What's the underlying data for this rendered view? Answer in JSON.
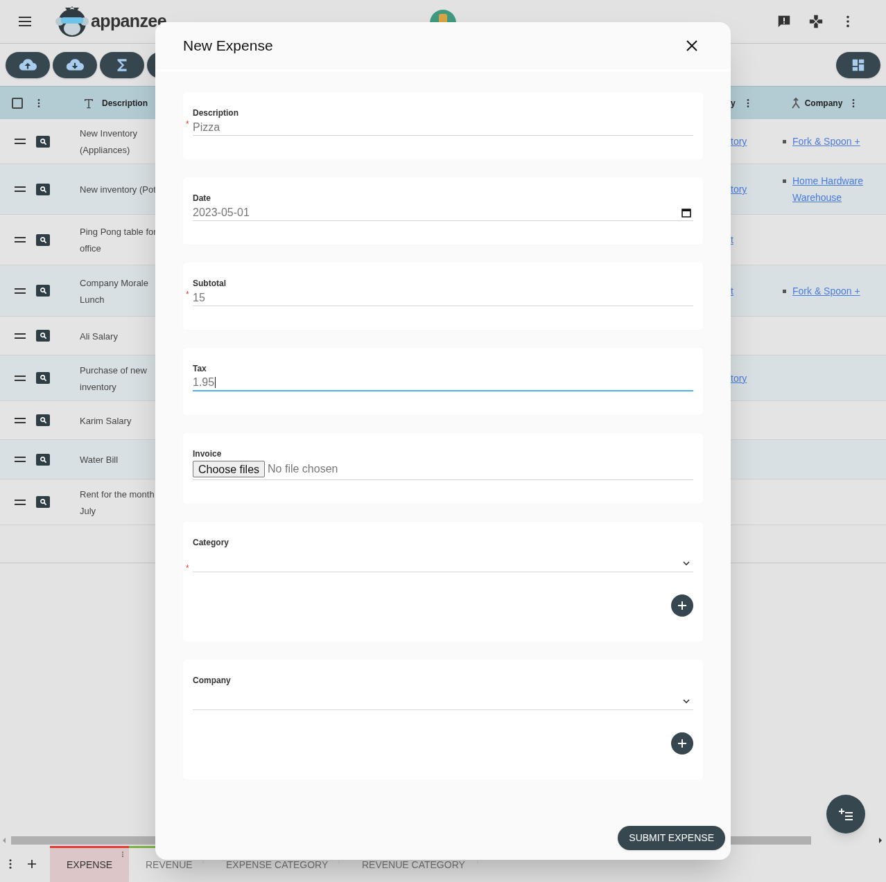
{
  "app": {
    "brand": "appanzee"
  },
  "table": {
    "select_all_checked": false,
    "columns": [
      {
        "label": "Description"
      },
      {
        "label": "y"
      },
      {
        "label": "Company"
      }
    ],
    "rows": [
      {
        "description": "New Inventory (Appliances)",
        "partial_link": "tory",
        "company": "Fork & Spoon +"
      },
      {
        "description": "New inventory (Pot",
        "partial_link": "tory",
        "company": "Home Hardware Warehouse"
      },
      {
        "description": "Ping Pong table for office",
        "partial_link": "t"
      },
      {
        "description": "Company Morale Lunch",
        "partial_link": "t",
        "company": "Fork & Spoon +"
      },
      {
        "description": "Ali Salary"
      },
      {
        "description": "Purchase of new inventory",
        "partial_link": "tory"
      },
      {
        "description": "Karim Salary"
      },
      {
        "description": "Water Bill"
      },
      {
        "description": "Rent for the month July"
      }
    ]
  },
  "dialog": {
    "title": "New Expense",
    "submit": "SUBMIT EXPENSE",
    "required_mark": "*",
    "fields": [
      {
        "kind": "text",
        "label": "Description",
        "required": true,
        "value": "Pizza",
        "focused": false
      },
      {
        "kind": "date",
        "label": "Date",
        "required": false,
        "value": "2023-05-01",
        "focused": false
      },
      {
        "kind": "text",
        "label": "Subtotal",
        "required": true,
        "value": "15",
        "focused": false
      },
      {
        "kind": "text",
        "label": "Tax",
        "required": false,
        "value": "1.95",
        "focused": true
      },
      {
        "kind": "file",
        "label": "Invoice",
        "required": false,
        "button_label": "Choose files",
        "status": "No file chosen"
      },
      {
        "kind": "select",
        "label": "Category",
        "required": true
      },
      {
        "kind": "select",
        "label": "Company",
        "required": false
      }
    ]
  },
  "bottom_tabs": [
    {
      "label": "EXPENSE",
      "selected": true,
      "color": "#e53935"
    },
    {
      "label": "REVENUE",
      "selected": false,
      "color": "#7cb342"
    },
    {
      "label": "EXPENSE CATEGORY",
      "selected": false
    },
    {
      "label": "REVENUE CATEGORY",
      "selected": false
    }
  ]
}
